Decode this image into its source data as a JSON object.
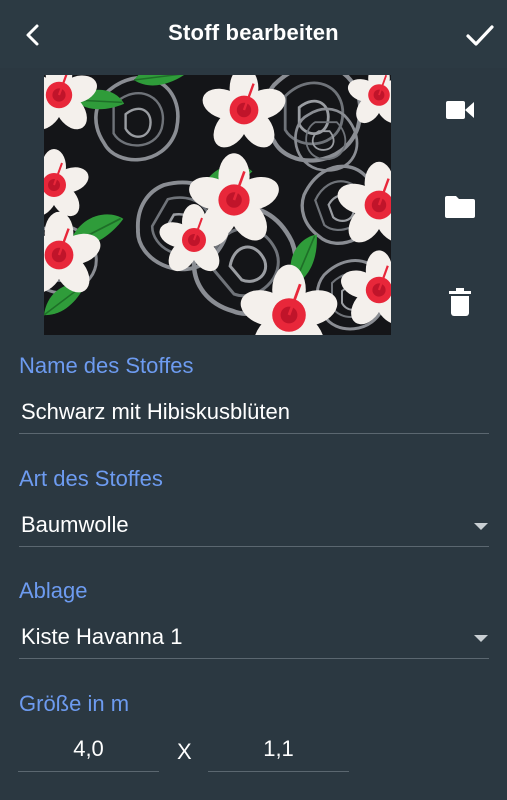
{
  "header": {
    "title": "Stoff bearbeiten"
  },
  "form": {
    "name": {
      "label": "Name des Stoffes",
      "value": "Schwarz mit Hibiskusblüten"
    },
    "type": {
      "label": "Art des Stoffes",
      "value": "Baumwolle"
    },
    "storage": {
      "label": "Ablage",
      "value": "Kiste Havanna 1"
    },
    "size": {
      "label": "Größe in m",
      "width": "4,0",
      "separator": "X",
      "height": "1,1"
    }
  },
  "icons": {
    "back": "arrow-back-icon",
    "save": "check-icon",
    "video": "videocam-icon",
    "folder": "folder-icon",
    "delete": "trash-icon"
  },
  "colors": {
    "background": "#2b3841",
    "accent_label": "#6d9bf0",
    "text": "#ffffff"
  }
}
